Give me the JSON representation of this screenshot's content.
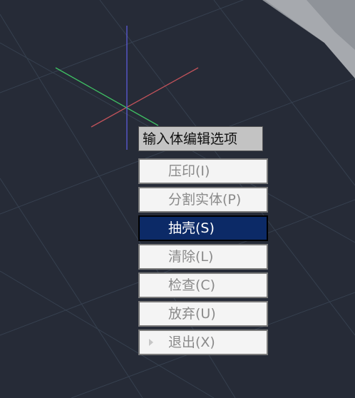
{
  "prompt": {
    "title": "输入体编辑选项"
  },
  "menu": {
    "items": [
      {
        "label": "压印(I)",
        "selected": false
      },
      {
        "label": "分割实体(P)",
        "selected": false
      },
      {
        "label": "抽壳(S)",
        "selected": true
      },
      {
        "label": "清除(L)",
        "selected": false
      },
      {
        "label": "检查(C)",
        "selected": false
      },
      {
        "label": "放弃(U)",
        "selected": false
      },
      {
        "label": "退出(X)",
        "selected": false,
        "arrow": true
      }
    ]
  },
  "colors": {
    "background": "#262b37",
    "grid": "#36404f",
    "selected_item": "#0c2a67",
    "axis_x": "#c0525a",
    "axis_y": "#3fbf63",
    "axis_z": "#5b5bd8"
  }
}
